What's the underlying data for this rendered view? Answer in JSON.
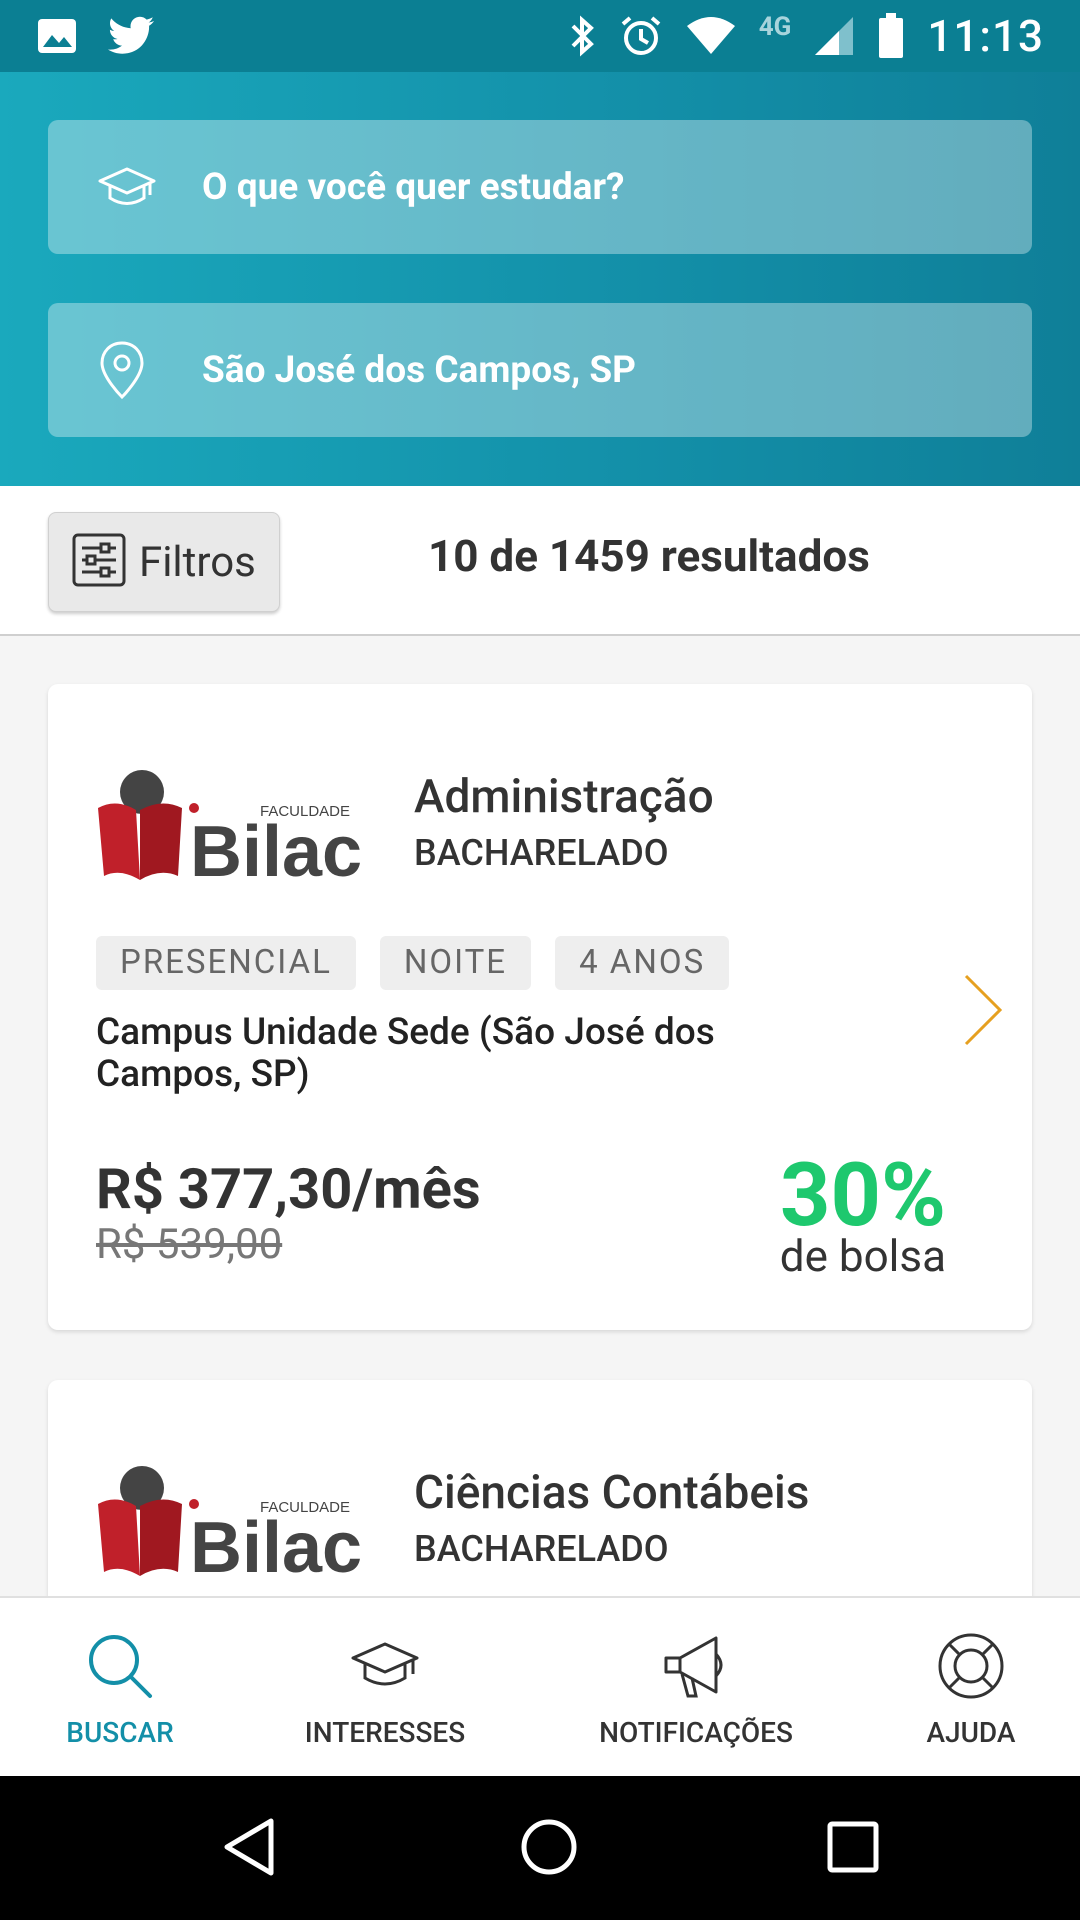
{
  "status_bar": {
    "time": "11:13",
    "network": "4G",
    "left_icons": [
      "image-icon",
      "twitter-icon"
    ],
    "right_icons": [
      "bluetooth-icon",
      "alarm-icon",
      "wifi-icon",
      "signal-icon",
      "battery-icon"
    ]
  },
  "search": {
    "course_placeholder": "O que você quer estudar?",
    "location_value": "São José dos Campos, SP"
  },
  "results": {
    "filter_label": "Filtros",
    "count_text": "10 de 1459 resultados"
  },
  "courses": [
    {
      "institution": "Faculdade Bilac",
      "logo_small_text": "FACULDADE",
      "logo_big_text": "Bilac",
      "name": "Administração",
      "degree": "BACHARELADO",
      "tags": [
        "PRESENCIAL",
        "NOITE",
        "4 ANOS"
      ],
      "campus": "Campus Unidade Sede (São José dos Campos, SP)",
      "price": "R$ 377,30/mês",
      "old_price": "R$ 539,00",
      "discount": "30%",
      "discount_label": "de bolsa"
    },
    {
      "institution": "Faculdade Bilac",
      "logo_small_text": "FACULDADE",
      "logo_big_text": "Bilac",
      "name": "Ciências Contábeis",
      "degree": "BACHARELADO"
    }
  ],
  "bottom_nav": [
    {
      "label": "BUSCAR",
      "icon": "search-icon",
      "active": true
    },
    {
      "label": "INTERESSES",
      "icon": "graduation-cap-icon",
      "active": false
    },
    {
      "label": "NOTIFICAÇÕES",
      "icon": "megaphone-icon",
      "active": false
    },
    {
      "label": "AJUDA",
      "icon": "lifebuoy-icon",
      "active": false
    }
  ],
  "colors": {
    "status_bar": "#0b7f93",
    "header_start": "#1aa9bd",
    "header_end": "#0f7f98",
    "accent": "#138fa8",
    "discount_green": "#1ec86e",
    "logo_red": "#c0202a",
    "chevron_orange": "#e6a020"
  }
}
